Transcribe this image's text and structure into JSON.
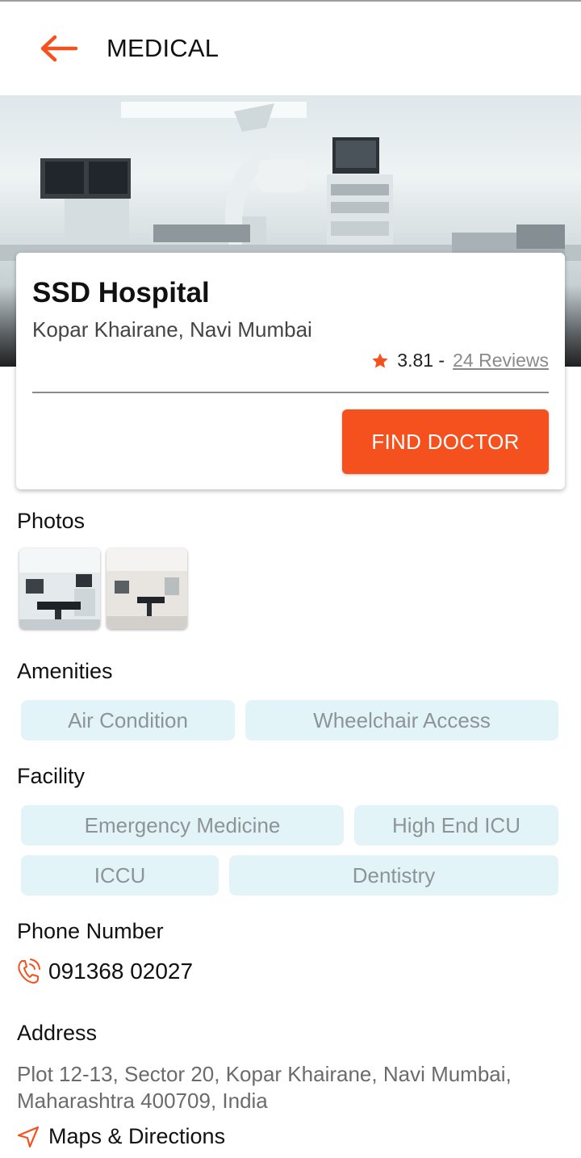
{
  "appbar": {
    "title": "MEDICAL",
    "back_icon": "arrow-left-icon"
  },
  "hospital": {
    "name": "SSD Hospital",
    "location": "Kopar Khairane, Navi Mumbai",
    "rating": "3.81 -",
    "reviews": "24 Reviews",
    "find_button": "FIND DOCTOR"
  },
  "photos": {
    "title": "Photos"
  },
  "amenities": {
    "title": "Amenities",
    "items": [
      "Air Condition",
      "Wheelchair Access"
    ]
  },
  "facility": {
    "title": "Facility",
    "items": [
      "Emergency Medicine",
      "High End ICU",
      "ICCU",
      "Dentistry"
    ]
  },
  "phone": {
    "title": "Phone Number",
    "number": "091368 02027",
    "icon": "phone-icon"
  },
  "address": {
    "title": "Address",
    "text": "Plot 12-13, Sector 20, Kopar Khairane, Navi Mumbai, Maharashtra 400709, India",
    "maps_label": "Maps & Directions",
    "maps_icon": "navigation-arrow-icon"
  },
  "colors": {
    "accent": "#f4511e",
    "chip_bg": "#e3f4f8",
    "chip_text": "#8d9498"
  }
}
